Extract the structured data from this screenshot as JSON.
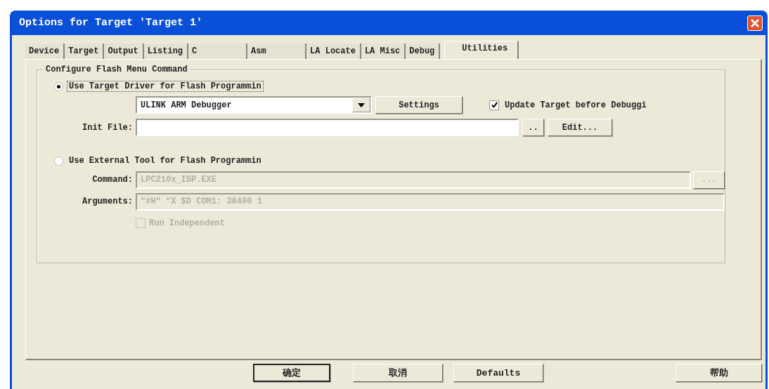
{
  "window": {
    "title": "Options for Target 'Target 1'"
  },
  "tabs": [
    {
      "label": "Device",
      "selected": false
    },
    {
      "label": "Target",
      "selected": false
    },
    {
      "label": "Output",
      "selected": false
    },
    {
      "label": "Listing",
      "selected": false
    },
    {
      "label": "C",
      "selected": false
    },
    {
      "label": "Asm",
      "selected": false
    },
    {
      "label": "LA Locate",
      "selected": false
    },
    {
      "label": "LA Misc",
      "selected": false
    },
    {
      "label": "Debug",
      "selected": false
    },
    {
      "label": "Utilities",
      "selected": true
    }
  ],
  "flash_menu": {
    "legend": "Configure Flash Menu Command",
    "target_driver": {
      "label": "Use Target Driver for Flash Programmin",
      "selected": true,
      "driver": "ULINK ARM Debugger",
      "settings_button": "Settings",
      "update_target": {
        "label": "Update Target before Debuggi",
        "checked": true
      },
      "init_file_label": "Init File:",
      "browse_button": "..",
      "edit_button": "Edit..."
    },
    "external_tool": {
      "label": "Use External Tool for Flash Programmin",
      "selected": false,
      "command": {
        "label": "Command:",
        "value": "LPC210x_ISP.EXE"
      },
      "browse_button": "...",
      "arguments": {
        "label": "Arguments:",
        "value": "\"#H\" \"X $D COM1: 38400 1"
      },
      "run_independent": {
        "label": "Run Independent",
        "checked": false
      }
    }
  },
  "buttons": [
    {
      "label": "确定",
      "kind": "default"
    },
    {
      "label": "取消",
      "kind": "normal"
    },
    {
      "label": "Defaults",
      "kind": "normal"
    },
    {
      "label": "帮助",
      "kind": "help"
    }
  ]
}
